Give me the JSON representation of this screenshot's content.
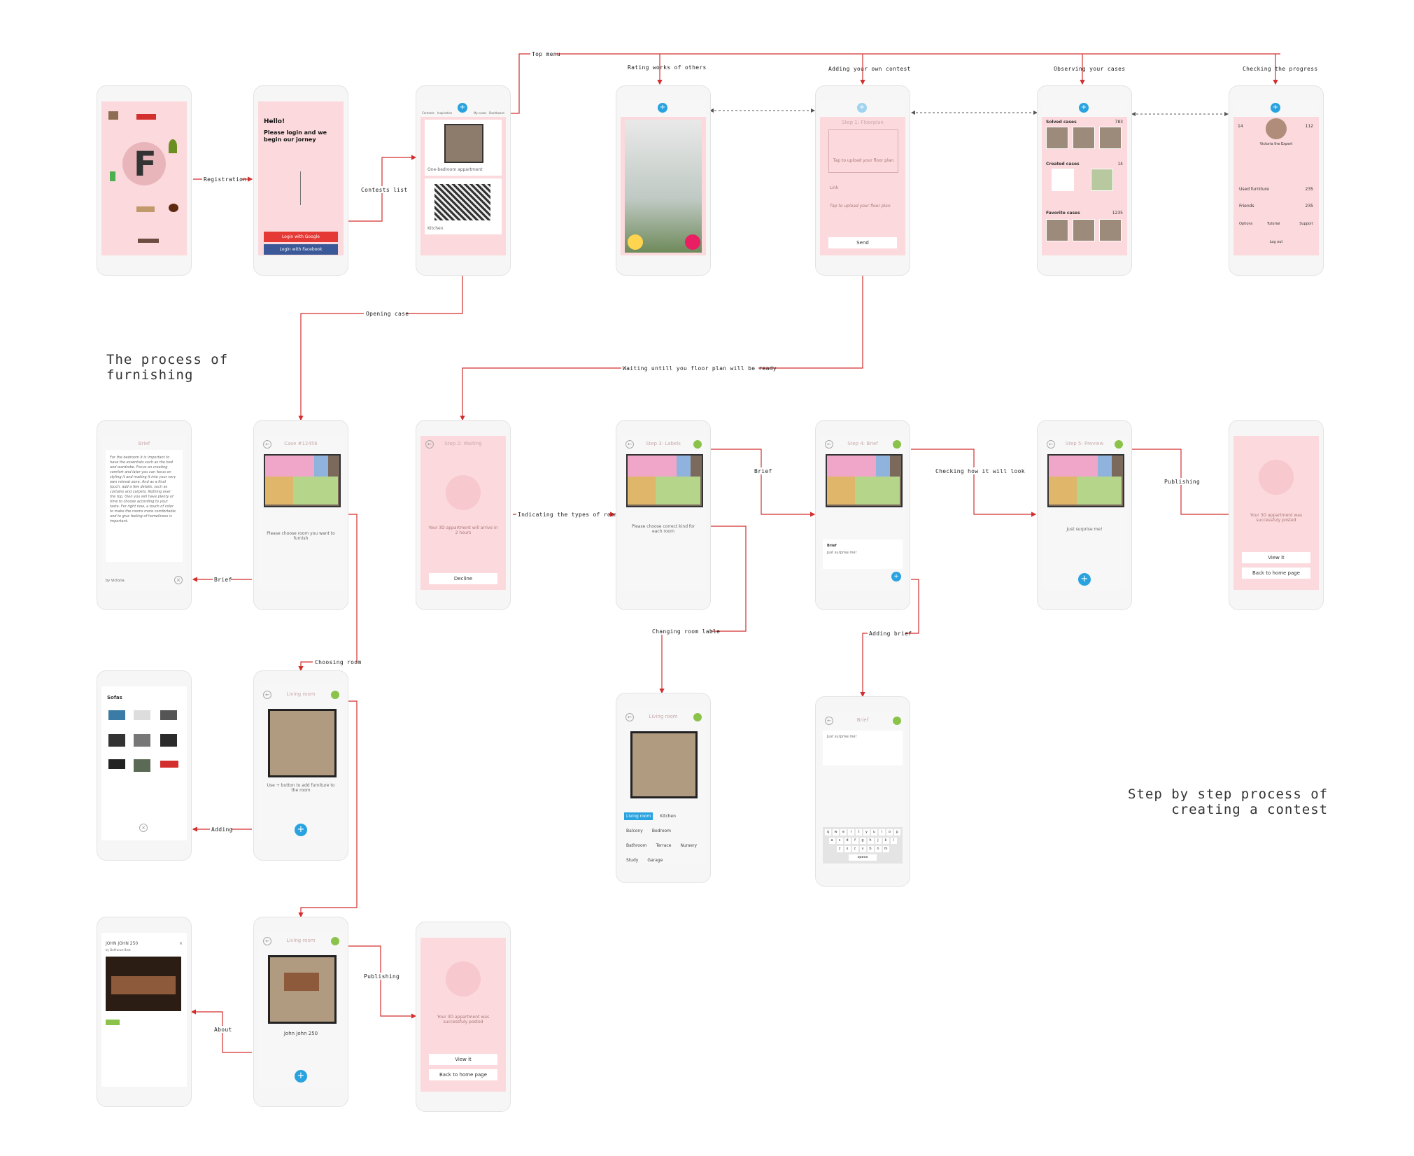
{
  "colors": {
    "connector": "#d32f2f",
    "dashed": "#555555",
    "screen_pink": "#fbd9dc",
    "accent_blue": "#29a3e0",
    "accent_green": "#8bc34a",
    "google_red": "#e53935",
    "facebook_blue": "#3b5998"
  },
  "headings": {
    "left": "The process of\nfurnishing",
    "right": "Step by step process of\ncreating a contest"
  },
  "flows": {
    "registration": "Registration",
    "contests_list": "Contests list",
    "top_menu": "Top menu",
    "rating": "Rating works of others",
    "adding_contest": "Adding your own contest",
    "observing": "Observing your cases",
    "checking": "Checking the progress",
    "opening_case": "Opening case",
    "waiting": "Waiting untill you floor plan will be ready",
    "indicating": "Indicating the types of rooms",
    "brief1": "Brief",
    "checking_look": "Checking how it will look",
    "publishing1": "Publishing",
    "brief2": "Brief",
    "changing": "Changing room lable",
    "adding_brief": "Adding brief",
    "choosing": "Choosing room",
    "adding": "Adding",
    "about": "About",
    "publishing2": "Publishing"
  },
  "screens": {
    "login": {
      "hello": "Hello!",
      "subtitle": "Please login and we begin our jorney",
      "google": "Login with Google",
      "facebook": "Login with Facebook"
    },
    "contests": {
      "tabs": [
        "Contests",
        "Inspiration",
        "",
        "My cases",
        "Dashboard"
      ],
      "item1": "One-bedroom appartment",
      "item2": "Kitchen"
    },
    "floorplan": {
      "title": "Step 1: Floorplan",
      "upload": "Tap to upload your floor plan",
      "link": "Link",
      "upload2": "Tap to upload your floor plan",
      "send": "Send"
    },
    "cases": {
      "solved": "Solved cases",
      "solved_n": "783",
      "created": "Created cases",
      "created_n": "14",
      "favorite": "Favorite cases",
      "favorite_n": "1235"
    },
    "profile": {
      "left_n": "14",
      "right_n": "112",
      "name": "Victoria the Expert",
      "used": "Used furniture",
      "used_n": "235",
      "friends": "Friends",
      "friends_n": "235",
      "options": "Options",
      "tutorial": "Tutorial",
      "support": "Support",
      "logout": "Log out"
    },
    "brief_view": {
      "title": "Brief",
      "text": "For the bedroom it is important to have the essentials such as the bed and wardrobe. Focus on creating comfort and later you can focus on styling it and making it into your very own retreat zone. And as a final touch, add a few details, such as curtains and carpets. Nothing over the top, then you will have plenty of time to choose according to your taste. For right now, a touch of color to make the rooms more comfortable and to give feeling of homeliness is important.",
      "by": "by Victoria"
    },
    "case": {
      "title": "Case #12456",
      "hint": "Please choose room you want to furnish"
    },
    "waiting": {
      "title": "Step 2: Waiting",
      "text": "Your 3D appartment will arrive in 2 hours",
      "decline": "Decline"
    },
    "labels": {
      "title": "Step 3: Labels",
      "hint": "Please choose correct kind for each room"
    },
    "brief_step": {
      "title": "Step 4: Brief",
      "label": "Brief",
      "text": "Just surprise me!"
    },
    "preview": {
      "title": "Step 5: Preview",
      "text": "Just surprise me!"
    },
    "posted": {
      "text": "Your 3D appartment was successfuly posted",
      "view": "View it",
      "home": "Back to home page"
    },
    "sofas": {
      "title": "Sofas"
    },
    "living": {
      "title": "Living room",
      "hint": "Use + button to add furniture to the room"
    },
    "label_pick": {
      "title": "Living room",
      "chips": [
        "Living room",
        "Kitchen",
        "Balcony",
        "Bedroom",
        "Bathroom",
        "Terrace",
        "Nursery",
        "Study",
        "Garage"
      ]
    },
    "brief_edit": {
      "title": "Brief",
      "text": "Just surprise me!",
      "space": "space",
      "keys1": [
        "q",
        "w",
        "e",
        "r",
        "t",
        "y",
        "u",
        "i",
        "o",
        "p"
      ],
      "keys2": [
        "a",
        "s",
        "d",
        "f",
        "g",
        "h",
        "j",
        "k",
        "l"
      ],
      "keys3": [
        "z",
        "x",
        "c",
        "v",
        "b",
        "n",
        "m"
      ]
    },
    "product": {
      "title": "JOHN JOHN 250",
      "by": "by Delfrance Best"
    },
    "living2": {
      "title": "Living room",
      "name": "John John 250"
    },
    "posted2": {
      "text": "Your 3D appartment was successfuly posted",
      "view": "View it",
      "home": "Back to home page"
    }
  }
}
